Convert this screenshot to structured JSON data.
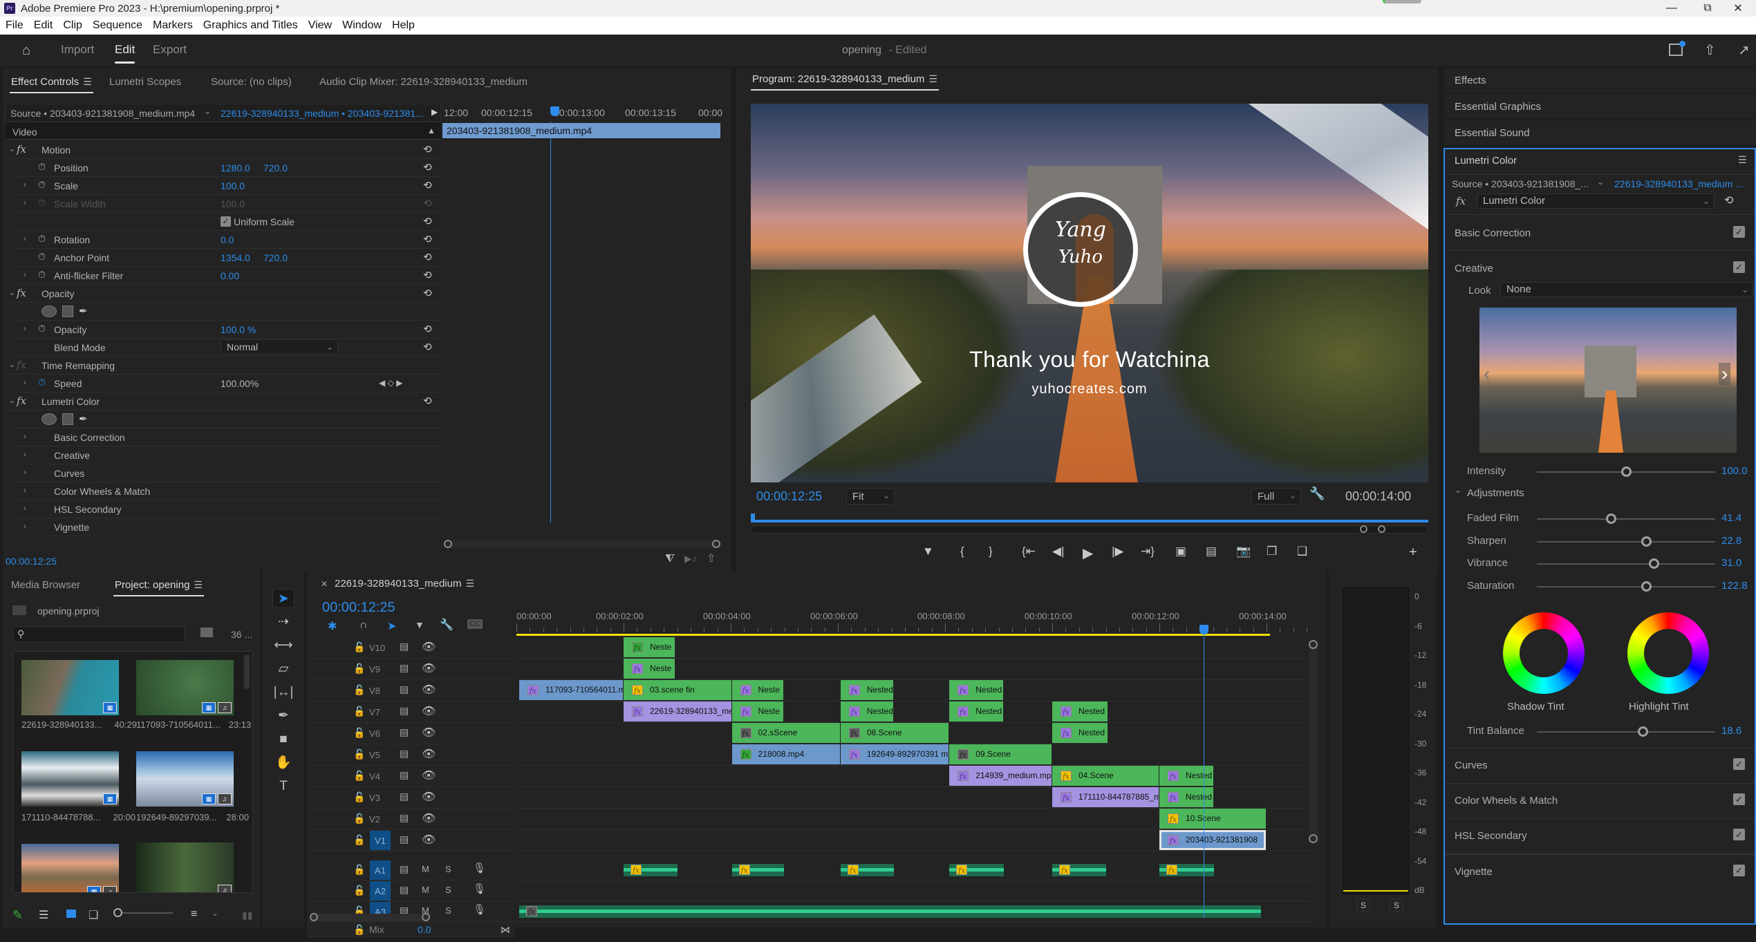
{
  "window": {
    "app_icon": "Pr",
    "title": "Adobe Premiere Pro 2023 - H:\\premium\\opening.prproj *",
    "controls": [
      "minimize",
      "restore",
      "close"
    ]
  },
  "menu": [
    "File",
    "Edit",
    "Clip",
    "Sequence",
    "Markers",
    "Graphics and Titles",
    "View",
    "Window",
    "Help"
  ],
  "workspace": {
    "tabs": [
      {
        "label": "Import",
        "active": false
      },
      {
        "label": "Edit",
        "active": true
      },
      {
        "label": "Export",
        "active": false
      }
    ],
    "project_name": "opening",
    "project_status": "- Edited"
  },
  "effect_controls": {
    "tabs": [
      {
        "label": "Effect Controls",
        "active": true
      },
      {
        "label": "Lumetri Scopes",
        "active": false
      },
      {
        "label": "Source: (no clips)",
        "active": false
      },
      {
        "label": "Audio Clip Mixer: 22619-328940133_medium",
        "active": false
      }
    ],
    "source_label": "Source • 203403-921381908_medium.mp4",
    "sequence_label": "22619-328940133_medium • 203403-921381...",
    "ruler": [
      "12:00",
      "00:00:12:15",
      "00:00:13:00",
      "00:00:13:15",
      "00:00"
    ],
    "clip_name": "203403-921381908_medium.mp4",
    "section": "Video",
    "rows": {
      "motion": "Motion",
      "position": {
        "label": "Position",
        "x": "1280.0",
        "y": "720.0"
      },
      "scale": {
        "label": "Scale",
        "value": "100.0"
      },
      "scale_width": {
        "label": "Scale Width",
        "value": "100.0"
      },
      "uniform_scale": {
        "label": "Uniform Scale",
        "checked": true
      },
      "rotation": {
        "label": "Rotation",
        "value": "0.0"
      },
      "anchor_point": {
        "label": "Anchor Point",
        "x": "1354.0",
        "y": "720.0"
      },
      "anti_flicker": {
        "label": "Anti-flicker Filter",
        "value": "0.00"
      },
      "opacity_group": "Opacity",
      "opacity": {
        "label": "Opacity",
        "value": "100.0 %"
      },
      "blend_mode": {
        "label": "Blend Mode",
        "value": "Normal"
      },
      "time_remapping": "Time Remapping",
      "speed": {
        "label": "Speed",
        "value": "100.00%"
      },
      "lumetri": "Lumetri Color",
      "lumetri_sections": [
        "Basic Correction",
        "Creative",
        "Curves",
        "Color Wheels & Match",
        "HSL Secondary",
        "Vignette"
      ]
    },
    "timecode": "00:00:12:25"
  },
  "program": {
    "title": "Program: 22619-328940133_medium",
    "overlay": {
      "logo_line1": "Yang",
      "logo_line2": "Yuho",
      "headline": "Thank you for Watchina",
      "url": "yuhocreates.com"
    },
    "timecode": "00:00:12:25",
    "zoom": "Fit",
    "resolution": "Full",
    "duration": "00:00:14:00",
    "playhead_fraction": 0.0,
    "transport": [
      "marker",
      "mark-in",
      "mark-out",
      "go-to-in",
      "step-back",
      "play",
      "step-forward",
      "go-to-out",
      "lift",
      "extract",
      "export-frame",
      "insert",
      "overwrite",
      "add"
    ]
  },
  "right_panel": {
    "collapsed": [
      "Effects",
      "Essential Graphics",
      "Essential Sound"
    ],
    "lumetri": {
      "title": "Lumetri Color",
      "source": "Source • 203403-921381908_...",
      "sequence": "22619-328940133_medium ...",
      "effect": "Lumetri Color",
      "sections": {
        "basic_correction": {
          "label": "Basic Correction",
          "enabled": true
        },
        "creative": {
          "label": "Creative",
          "enabled": true
        },
        "curves": {
          "label": "Curves",
          "enabled": true
        },
        "color_wheels": {
          "label": "Color Wheels & Match",
          "enabled": true
        },
        "hsl": {
          "label": "HSL Secondary",
          "enabled": true
        },
        "vignette": {
          "label": "Vignette",
          "enabled": true
        }
      },
      "look_label": "Look",
      "look_value": "None",
      "intensity": {
        "label": "Intensity",
        "value": "100.0",
        "fraction": 0.5
      },
      "adjustments_label": "Adjustments",
      "adjustments": [
        {
          "label": "Faded Film",
          "value": "41.4",
          "fraction": 0.414
        },
        {
          "label": "Sharpen",
          "value": "22.8",
          "fraction": 0.614
        },
        {
          "label": "Vibrance",
          "value": "31.0",
          "fraction": 0.655
        },
        {
          "label": "Saturation",
          "value": "122.8",
          "fraction": 0.614
        }
      ],
      "shadow_tint": "Shadow Tint",
      "highlight_tint": "Highlight Tint",
      "tint_balance": {
        "label": "Tint Balance",
        "value": "18.6",
        "fraction": 0.593
      }
    }
  },
  "project": {
    "tabs": [
      {
        "label": "Media Browser",
        "active": false
      },
      {
        "label": "Project: opening",
        "active": true
      }
    ],
    "file": "opening.prproj",
    "search_placeholder": "",
    "item_count": "36 ...",
    "items": [
      {
        "name": "22619-328940133...",
        "duration": "40:29",
        "video": true,
        "audio": false
      },
      {
        "name": "117093-710564011...",
        "duration": "23:13",
        "video": true,
        "audio": true
      },
      {
        "name": "171110-84478788...",
        "duration": "20:00",
        "video": true,
        "audio": false
      },
      {
        "name": "192649-89297039...",
        "duration": "28:00",
        "video": true,
        "audio": true
      },
      {
        "name": "",
        "duration": "",
        "video": true,
        "audio": true
      },
      {
        "name": "",
        "duration": "",
        "video": false,
        "audio": true
      }
    ]
  },
  "tools": [
    "selection",
    "track-select-forward",
    "ripple-edit",
    "razor",
    "slip",
    "pen",
    "rectangle",
    "hand",
    "type"
  ],
  "timeline": {
    "sequence": "22619-328940133_medium",
    "timecode": "00:00:12:25",
    "ruler": [
      "00:00:00",
      "00:00:02:00",
      "00:00:04:00",
      "00:00:06:00",
      "00:00:08:00",
      "00:00:10:00",
      "00:00:12:00",
      "00:00:14:00"
    ],
    "playhead_seconds": 12.83,
    "video_tracks": [
      {
        "name": "V10",
        "clips": [
          {
            "label": "Neste",
            "start": 2.0,
            "end": 2.97,
            "color": "green",
            "fx": "green"
          }
        ]
      },
      {
        "name": "V9",
        "clips": [
          {
            "label": "Neste",
            "start": 2.0,
            "end": 2.97,
            "color": "green",
            "fx": "purple"
          }
        ]
      },
      {
        "name": "V8",
        "clips": [
          {
            "label": "117093-710564011.m",
            "start": 0.05,
            "end": 2.0,
            "color": "blue",
            "fx": "purple"
          },
          {
            "label": "03.scene fin",
            "start": 2.0,
            "end": 4.02,
            "color": "green",
            "fx": "yellow"
          },
          {
            "label": "Neste",
            "start": 4.02,
            "end": 5.0,
            "color": "green",
            "fx": "purple"
          },
          {
            "label": "Nested",
            "start": 6.05,
            "end": 7.05,
            "color": "green",
            "fx": "purple"
          },
          {
            "label": "Nested",
            "start": 8.08,
            "end": 9.1,
            "color": "green",
            "fx": "purple"
          }
        ]
      },
      {
        "name": "V7",
        "clips": [
          {
            "label": "22619-328940133_me",
            "start": 2.0,
            "end": 4.02,
            "color": "purple",
            "fx": "purple"
          },
          {
            "label": "Neste",
            "start": 4.02,
            "end": 5.0,
            "color": "green",
            "fx": "purple"
          },
          {
            "label": "Nested",
            "start": 6.05,
            "end": 7.05,
            "color": "green",
            "fx": "purple"
          },
          {
            "label": "Nested",
            "start": 8.08,
            "end": 9.1,
            "color": "green",
            "fx": "purple"
          },
          {
            "label": "Nested",
            "start": 10.0,
            "end": 11.05,
            "color": "green",
            "fx": "purple"
          }
        ]
      },
      {
        "name": "V6",
        "clips": [
          {
            "label": "02.sScene",
            "start": 4.02,
            "end": 6.05,
            "color": "green",
            "fx": "gray"
          },
          {
            "label": "08.Scene",
            "start": 6.05,
            "end": 8.08,
            "color": "green",
            "fx": "gray"
          },
          {
            "label": "Nested",
            "start": 10.0,
            "end": 11.05,
            "color": "green",
            "fx": "purple"
          }
        ]
      },
      {
        "name": "V5",
        "clips": [
          {
            "label": "218008.mp4",
            "start": 4.02,
            "end": 6.05,
            "color": "blue",
            "fx": "green"
          },
          {
            "label": "192649-892970391 m",
            "start": 6.05,
            "end": 8.08,
            "color": "blue",
            "fx": "purple"
          },
          {
            "label": "09.Scene",
            "start": 8.08,
            "end": 10.0,
            "color": "green",
            "fx": "gray"
          }
        ]
      },
      {
        "name": "V4",
        "clips": [
          {
            "label": "214939_medium.mp",
            "start": 8.08,
            "end": 10.0,
            "color": "purple",
            "fx": "purple"
          },
          {
            "label": "04.Scene",
            "start": 10.0,
            "end": 12.0,
            "color": "green",
            "fx": "yellow"
          },
          {
            "label": "Nested",
            "start": 12.0,
            "end": 13.02,
            "color": "green",
            "fx": "purple"
          }
        ]
      },
      {
        "name": "V3",
        "clips": [
          {
            "label": "171110-844787885_m",
            "start": 10.0,
            "end": 12.0,
            "color": "purple",
            "fx": "purple"
          },
          {
            "label": "Nested",
            "start": 12.0,
            "end": 13.02,
            "color": "green",
            "fx": "purple"
          }
        ]
      },
      {
        "name": "V2",
        "clips": [
          {
            "label": "10.Scene",
            "start": 12.0,
            "end": 14.0,
            "color": "green",
            "fx": "yellow"
          }
        ]
      },
      {
        "name": "V1",
        "active": true,
        "clips": [
          {
            "label": "203403-921381908",
            "start": 12.0,
            "end": 14.0,
            "color": "blue",
            "fx": "purple",
            "selected": true
          }
        ]
      }
    ],
    "audio_tracks": [
      {
        "name": "A1",
        "clips": [
          {
            "start": 2.0,
            "end": 3.0
          },
          {
            "start": 4.02,
            "end": 5.0
          },
          {
            "start": 6.05,
            "end": 7.05
          },
          {
            "start": 8.08,
            "end": 9.1
          },
          {
            "start": 10.0,
            "end": 11.0
          },
          {
            "start": 12.0,
            "end": 13.02
          }
        ]
      },
      {
        "name": "A2",
        "clips": []
      },
      {
        "name": "A3",
        "clips": [
          {
            "start": 0.05,
            "end": 13.9
          }
        ]
      }
    ],
    "mix_label": "Mix",
    "mix_value": "0.0",
    "mute_label": "M",
    "solo_label": "S"
  },
  "meters": {
    "scale": [
      "0",
      "-6",
      "-12",
      "-18",
      "-24",
      "-30",
      "-36",
      "-42",
      "-48",
      "-54",
      "dB"
    ],
    "solo_buttons": [
      "S",
      "S"
    ]
  },
  "colors": {
    "accent": "#2d8ceb",
    "clip_green": "#4cb65a",
    "clip_blue": "#6c98cc",
    "clip_purple": "#a493e0",
    "audio": "#1e6a4d",
    "work_area": "#f0e000"
  }
}
